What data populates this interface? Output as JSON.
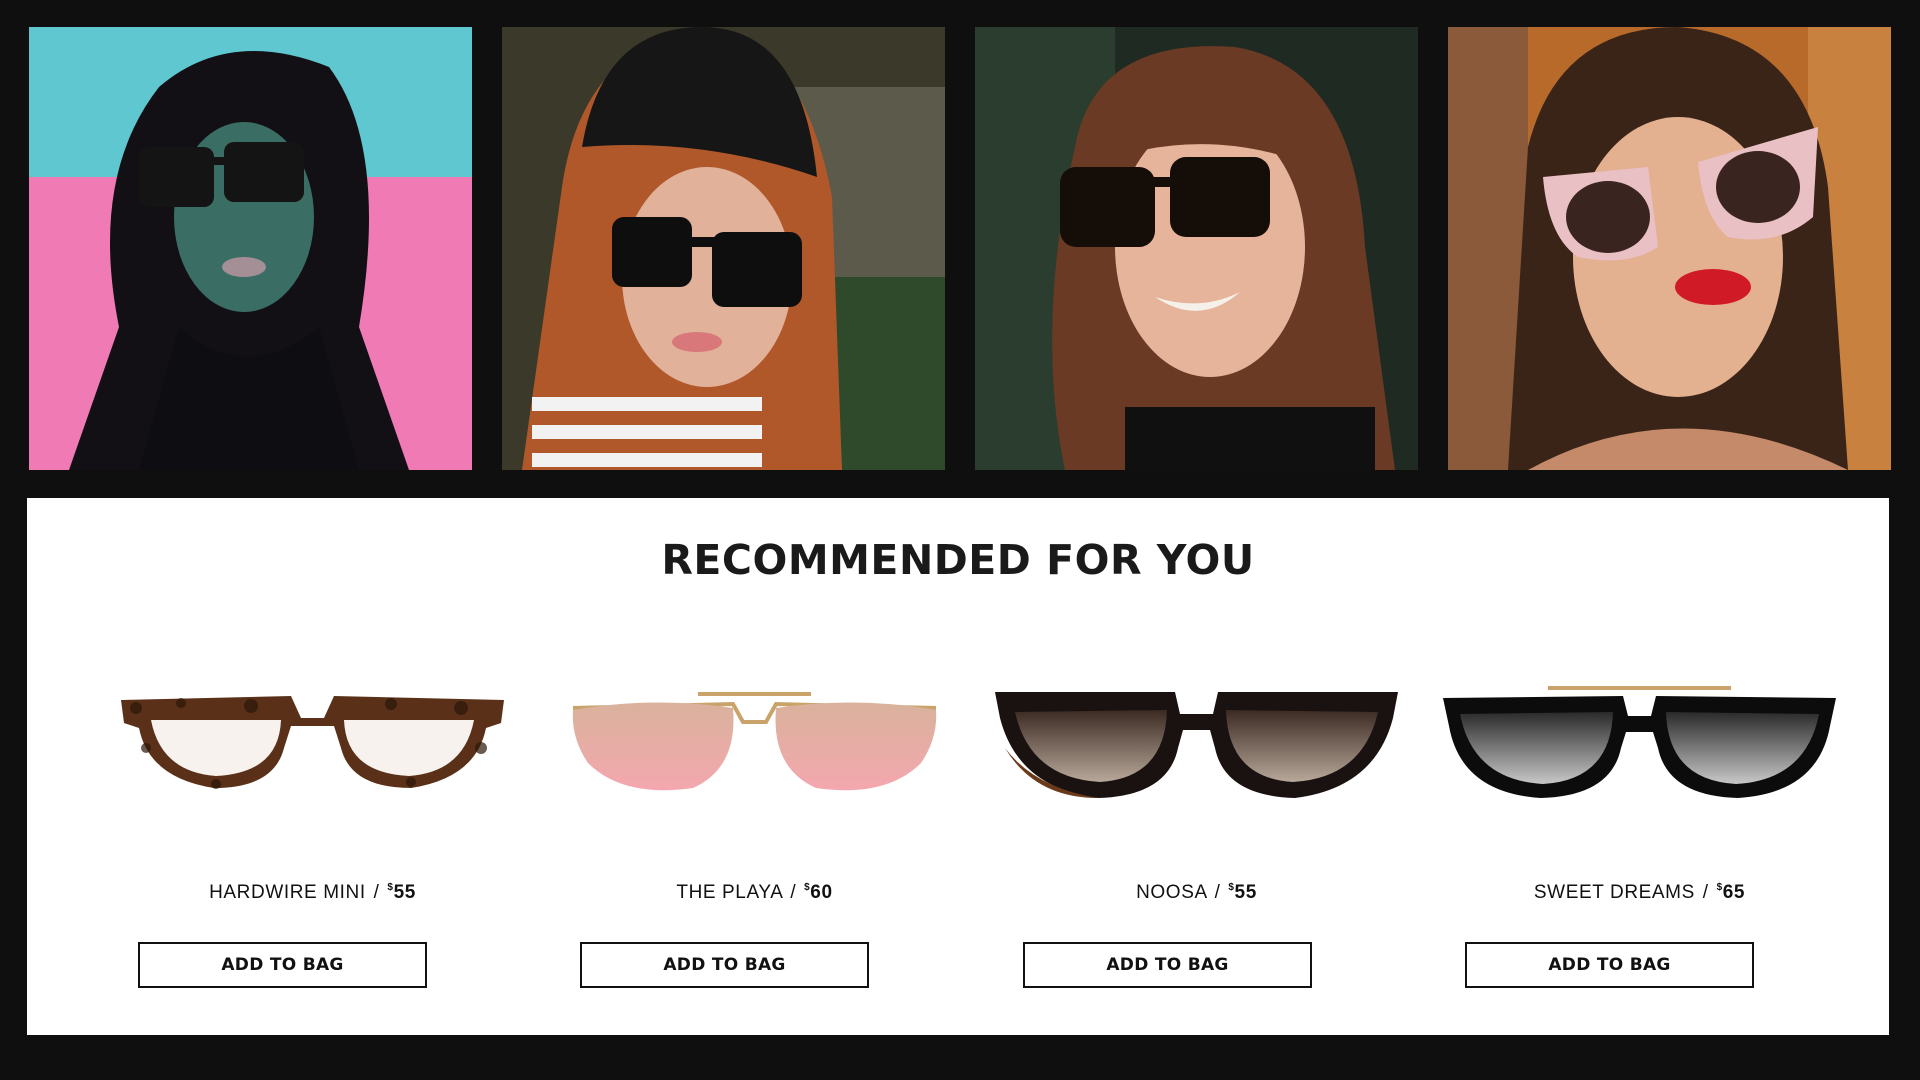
{
  "gallery": {
    "photos": [
      {
        "icon": "model-photo-1"
      },
      {
        "icon": "model-photo-2"
      },
      {
        "icon": "model-photo-3"
      },
      {
        "icon": "model-photo-4"
      }
    ]
  },
  "recommended": {
    "title": "RECOMMENDED FOR YOU",
    "products": [
      {
        "name": "HARDWIRE MINI",
        "separator": "/",
        "currency": "$",
        "price": "55",
        "button": "ADD TO BAG",
        "icon": "tortoise-glasses-icon"
      },
      {
        "name": "THE PLAYA",
        "separator": "/",
        "currency": "$",
        "price": "60",
        "button": "ADD TO BAG",
        "icon": "aviator-sunglasses-icon"
      },
      {
        "name": "NOOSA",
        "separator": "/",
        "currency": "$",
        "price": "55",
        "button": "ADD TO BAG",
        "icon": "cateye-sunglasses-icon"
      },
      {
        "name": "SWEET DREAMS",
        "separator": "/",
        "currency": "$",
        "price": "65",
        "button": "ADD TO BAG",
        "icon": "square-sunglasses-icon"
      }
    ]
  },
  "colors": {
    "background": "#0f0f0f",
    "panel": "#ffffff",
    "text": "#111111"
  }
}
